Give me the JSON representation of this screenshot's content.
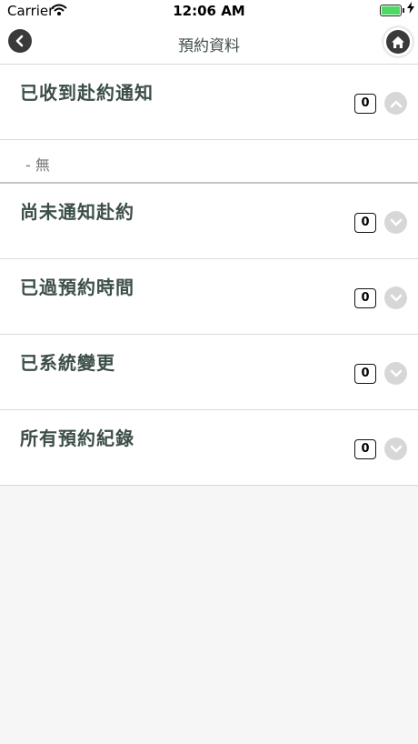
{
  "status_bar": {
    "carrier": "Carrier",
    "time": "12:06 AM"
  },
  "nav": {
    "title": "預約資料"
  },
  "sections": [
    {
      "title": "已收到赴約通知",
      "count": "0",
      "expanded": true
    },
    {
      "title": "尚未通知赴約",
      "count": "0",
      "expanded": false
    },
    {
      "title": "已過預約時間",
      "count": "0",
      "expanded": false
    },
    {
      "title": "已系統變更",
      "count": "0",
      "expanded": false
    },
    {
      "title": "所有預約紀錄",
      "count": "0",
      "expanded": false
    }
  ],
  "empty_text": "- 無",
  "colors": {
    "title_text": "#3c4e47",
    "icon_dark": "#3a3a3a",
    "chevron_bg": "#d7d7d7",
    "battery": "#4cd964"
  },
  "icons": {
    "back": "chevron-left-icon",
    "home": "home-icon",
    "expand": "chevron-down-icon",
    "collapse": "chevron-up-icon"
  }
}
